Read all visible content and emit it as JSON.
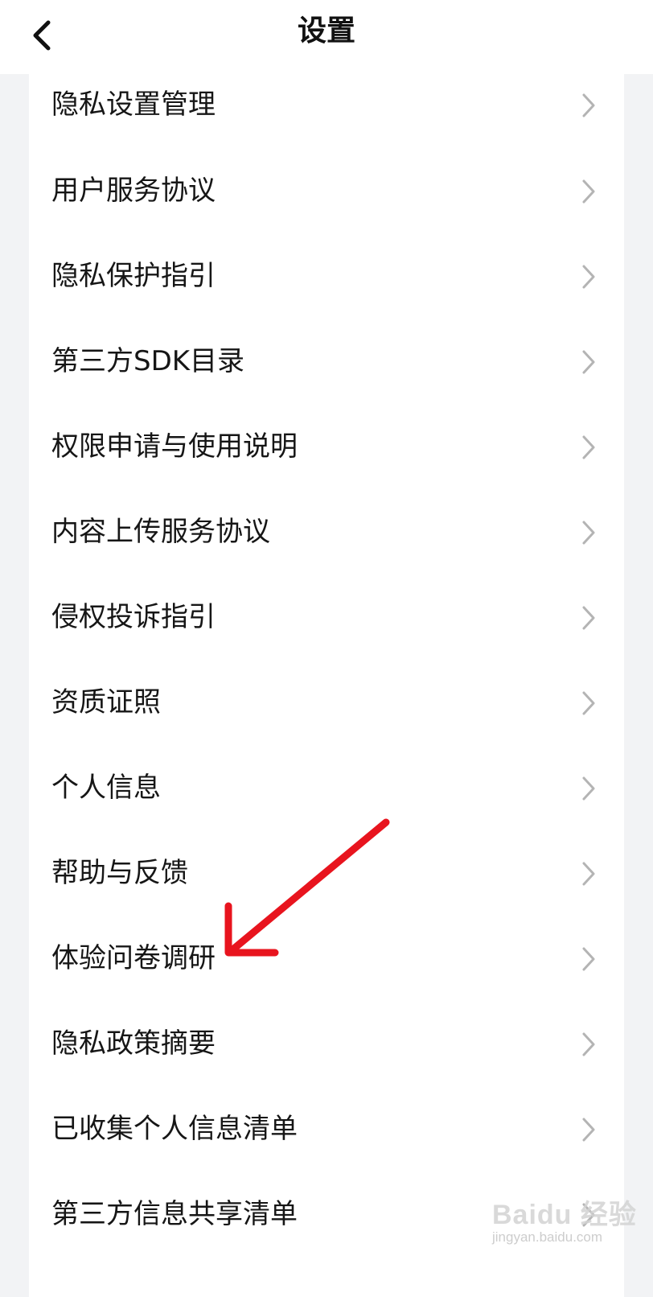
{
  "header": {
    "title": "设置",
    "back_icon": "chevron-left-icon"
  },
  "settings_list": {
    "items": [
      {
        "label": "隐私设置管理"
      },
      {
        "label": "用户服务协议"
      },
      {
        "label": "隐私保护指引"
      },
      {
        "label": "第三方SDK目录"
      },
      {
        "label": "权限申请与使用说明"
      },
      {
        "label": "内容上传服务协议"
      },
      {
        "label": "侵权投诉指引"
      },
      {
        "label": "资质证照"
      },
      {
        "label": "个人信息"
      },
      {
        "label": "帮助与反馈"
      },
      {
        "label": "体验问卷调研"
      },
      {
        "label": "隐私政策摘要"
      },
      {
        "label": "已收集个人信息清单"
      },
      {
        "label": "第三方信息共享清单"
      }
    ],
    "row_icon": "chevron-right-icon"
  },
  "annotation": {
    "type": "red-arrow",
    "color": "#e8141e",
    "points_to": "体验问卷调研"
  },
  "watermark": {
    "brand": "Baidu 经验",
    "url": "jingyan.baidu.com"
  },
  "colors": {
    "background": "#f2f3f5",
    "card": "#ffffff",
    "text": "#161616",
    "chevron": "#b4b4b4"
  }
}
